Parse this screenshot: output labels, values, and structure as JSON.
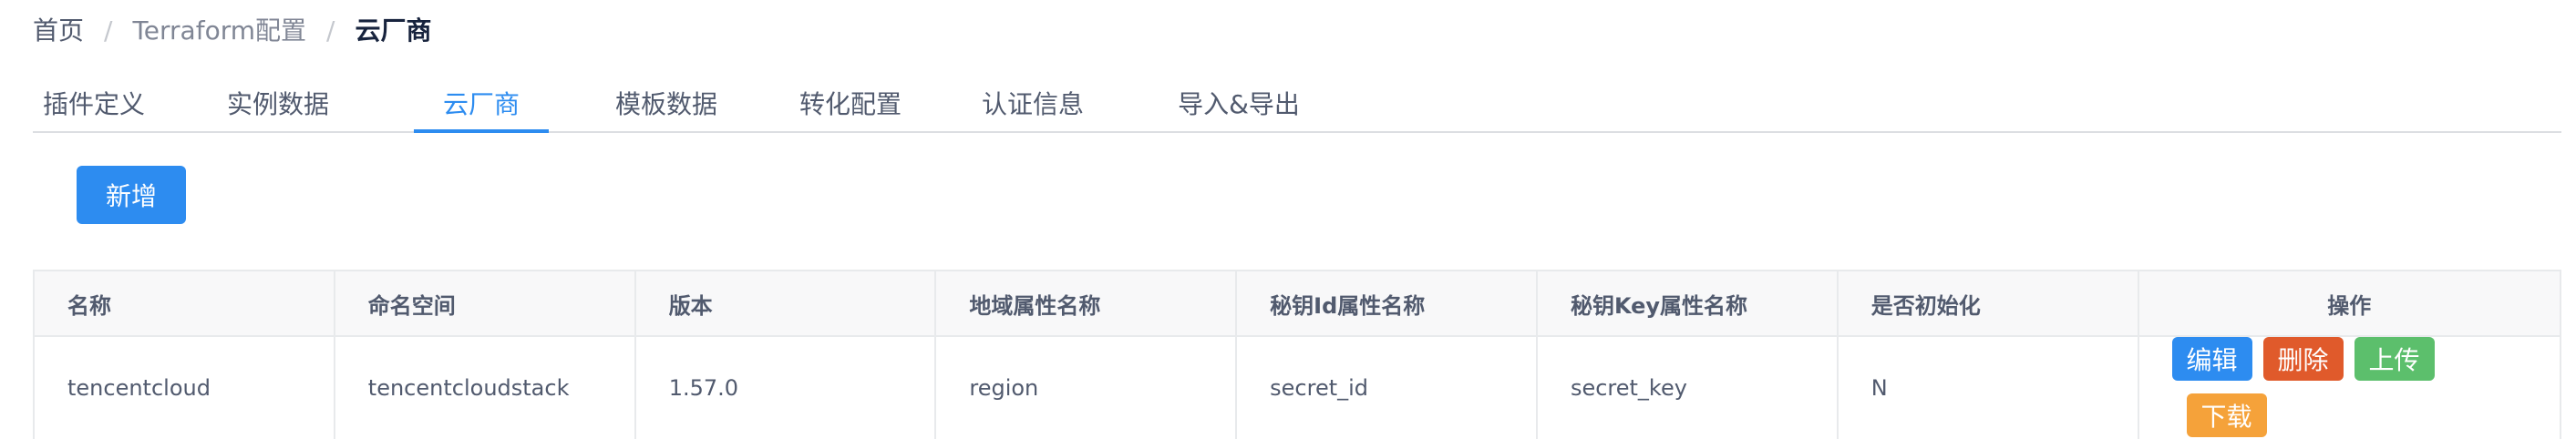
{
  "breadcrumb": {
    "home": "首页",
    "parent": "Terraform配置",
    "current": "云厂商",
    "separator": "/"
  },
  "tabs": [
    {
      "label": "插件定义",
      "active": false
    },
    {
      "label": "实例数据",
      "active": false
    },
    {
      "label": "云厂商",
      "active": true
    },
    {
      "label": "模板数据",
      "active": false
    },
    {
      "label": "转化配置",
      "active": false
    },
    {
      "label": "认证信息",
      "active": false
    },
    {
      "label": "导入&导出",
      "active": false
    }
  ],
  "toolbar": {
    "add_label": "新增"
  },
  "table": {
    "columns": [
      "名称",
      "命名空间",
      "版本",
      "地域属性名称",
      "秘钥Id属性名称",
      "秘钥Key属性名称",
      "是否初始化",
      "操作"
    ],
    "rows": [
      {
        "name": "tencentcloud",
        "namespace": "tencentcloudstack",
        "version": "1.57.0",
        "region_attr": "region",
        "secret_id_attr": "secret_id",
        "secret_key_attr": "secret_key",
        "initialized": "N"
      }
    ],
    "actions": {
      "edit": "编辑",
      "delete": "删除",
      "upload": "上传",
      "download": "下载"
    }
  },
  "colors": {
    "primary": "#2d8cf0",
    "danger": "#e05a2b",
    "success": "#5cbf6c",
    "warning": "#f5a23a"
  }
}
